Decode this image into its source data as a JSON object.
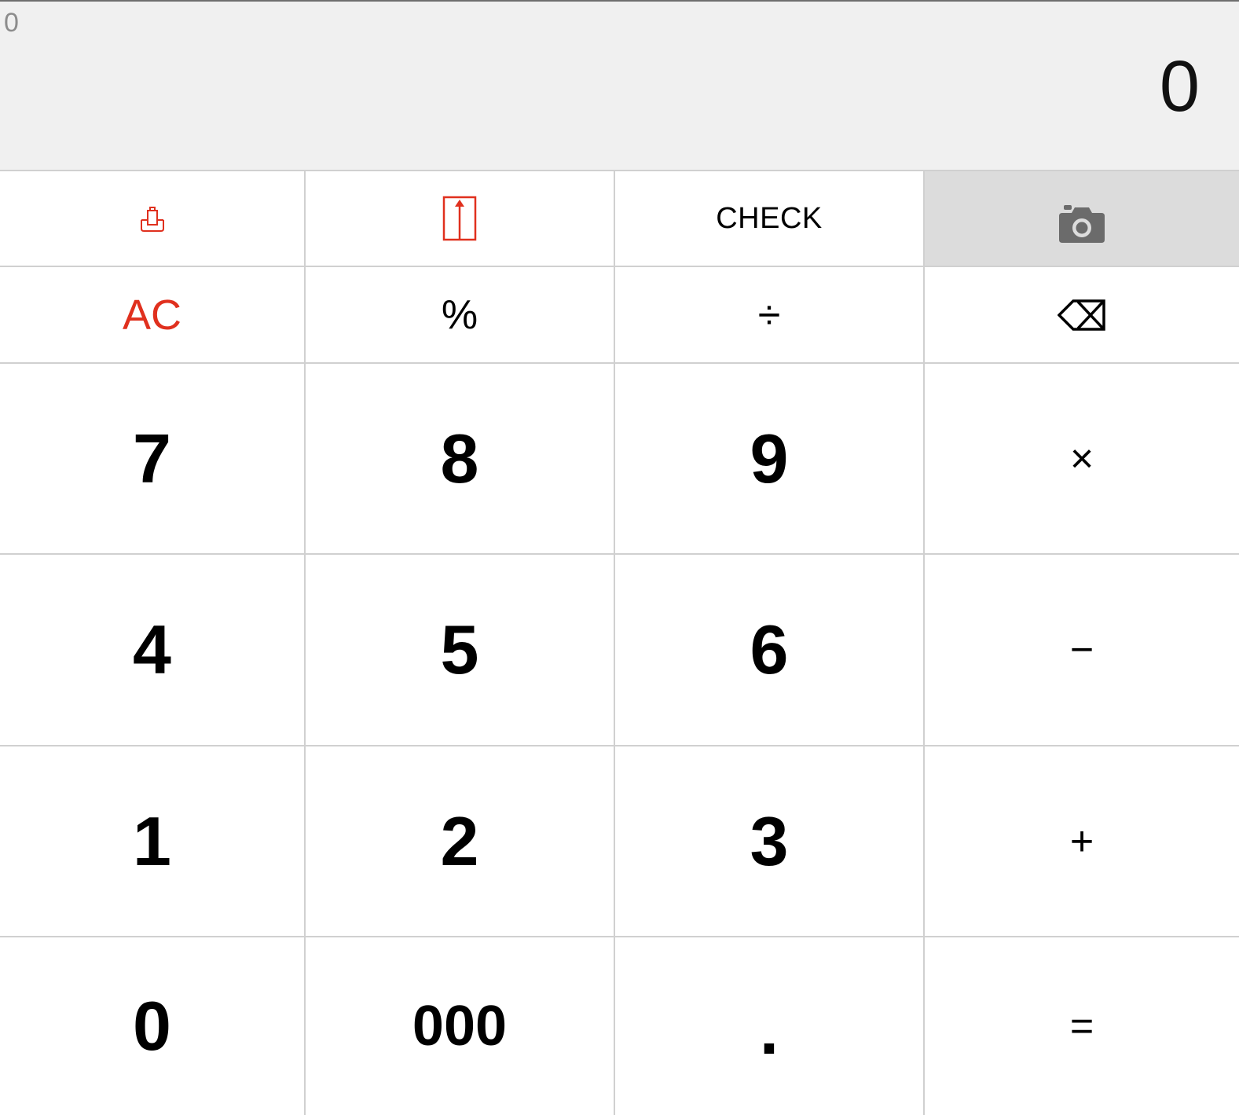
{
  "display": {
    "expression": "0",
    "result": "0"
  },
  "top_row": {
    "check_label": "CHECK",
    "icons": [
      "tax-stamp-icon",
      "upload-icon",
      "camera-icon"
    ]
  },
  "colors": {
    "accent_red": "#e0301e",
    "display_bg": "#f0f0f0",
    "camera_key_bg": "#dcdcdc",
    "grid_line": "#d0d0d0",
    "camera_icon": "#6b6b6b"
  },
  "keys": {
    "ac": "AC",
    "percent": "%",
    "divide": "÷",
    "backspace_icon": "backspace-icon",
    "seven": "7",
    "eight": "8",
    "nine": "9",
    "multiply": "×",
    "four": "4",
    "five": "5",
    "six": "6",
    "minus": "−",
    "one": "1",
    "two": "2",
    "three": "3",
    "plus": "+",
    "zero": "0",
    "triple_zero": "000",
    "decimal": ".",
    "equals": "="
  }
}
